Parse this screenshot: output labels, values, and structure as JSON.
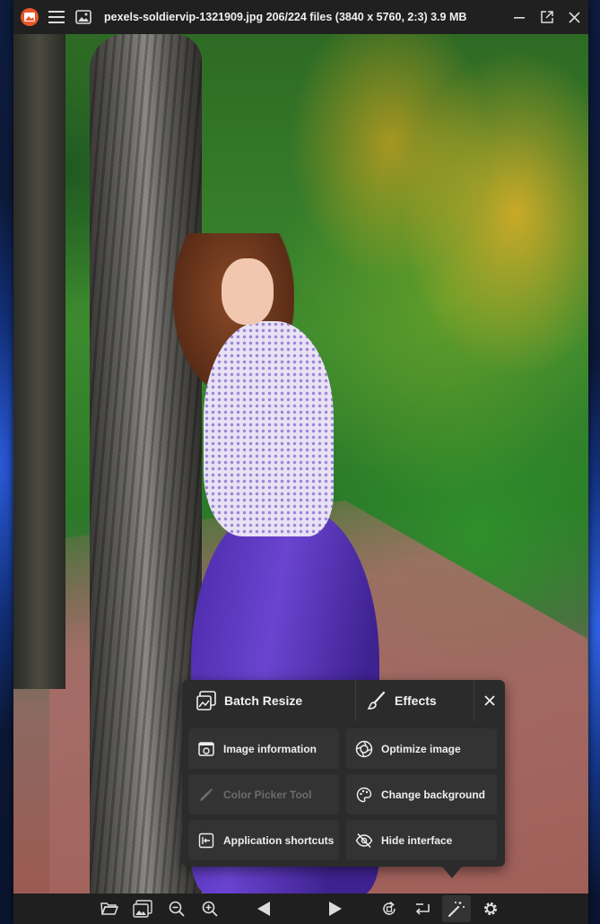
{
  "window": {
    "title": "pexels-soldiervip-1321909.jpg 206/224 files (3840 x 5760, 2:3) 3.9 MB"
  },
  "popup": {
    "batch_resize": "Batch Resize",
    "effects": "Effects",
    "items": [
      {
        "label": "Image information",
        "icon": "image-info-icon",
        "enabled": true
      },
      {
        "label": "Optimize image",
        "icon": "optimize-icon",
        "enabled": true
      },
      {
        "label": "Color Picker Tool",
        "icon": "eyedropper-icon",
        "enabled": false
      },
      {
        "label": "Change background",
        "icon": "palette-icon",
        "enabled": true
      },
      {
        "label": "Application shortcuts",
        "icon": "shortcut-icon",
        "enabled": true
      },
      {
        "label": "Hide interface",
        "icon": "eye-off-icon",
        "enabled": true
      }
    ]
  },
  "toolbar": {
    "tools": [
      "open-folder",
      "gallery",
      "zoom-out",
      "zoom-in",
      "previous",
      "next",
      "rotate",
      "flip",
      "magic-wand",
      "settings"
    ],
    "active_tool": "magic-wand"
  },
  "colors": {
    "titlebar": "#202020",
    "popup_bg": "#2b2b2b",
    "button_bg": "#333333",
    "logo_orange": "#e8562a"
  }
}
